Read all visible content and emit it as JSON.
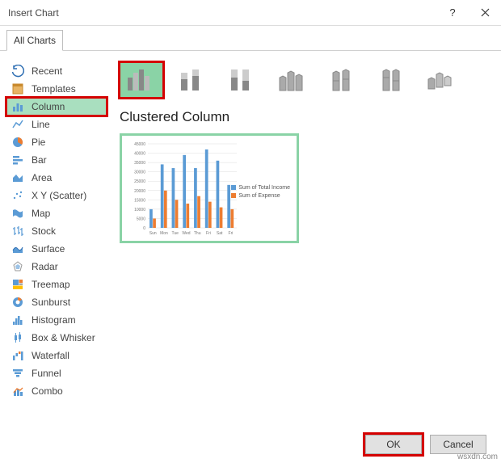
{
  "titlebar": {
    "title": "Insert Chart"
  },
  "tab_label": "All Charts",
  "sidebar": {
    "items": [
      {
        "label": "Recent"
      },
      {
        "label": "Templates"
      },
      {
        "label": "Column"
      },
      {
        "label": "Line"
      },
      {
        "label": "Pie"
      },
      {
        "label": "Bar"
      },
      {
        "label": "Area"
      },
      {
        "label": "X Y (Scatter)"
      },
      {
        "label": "Map"
      },
      {
        "label": "Stock"
      },
      {
        "label": "Surface"
      },
      {
        "label": "Radar"
      },
      {
        "label": "Treemap"
      },
      {
        "label": "Sunburst"
      },
      {
        "label": "Histogram"
      },
      {
        "label": "Box & Whisker"
      },
      {
        "label": "Waterfall"
      },
      {
        "label": "Funnel"
      },
      {
        "label": "Combo"
      }
    ]
  },
  "chart_title": "Clustered Column",
  "buttons": {
    "ok": "OK",
    "cancel": "Cancel"
  },
  "watermark": "wsxdn.com",
  "legend": {
    "s1": "Sum of Total Income",
    "s2": "Sum of Expense"
  },
  "chart_data": {
    "type": "bar",
    "categories": [
      "Sun",
      "Mon",
      "Tue",
      "Wed",
      "Thu",
      "Fri",
      "Sat",
      "Fri"
    ],
    "series": [
      {
        "name": "Sum of Total Income",
        "values": [
          10000,
          34000,
          32000,
          39000,
          32000,
          42000,
          36000,
          23000
        ]
      },
      {
        "name": "Sum of Expense",
        "values": [
          5000,
          20000,
          15000,
          13000,
          17000,
          14000,
          11000,
          10000
        ]
      }
    ],
    "ylim": [
      0,
      45000
    ],
    "yticks": [
      0,
      5000,
      10000,
      15000,
      20000,
      25000,
      30000,
      35000,
      40000,
      45000
    ]
  }
}
